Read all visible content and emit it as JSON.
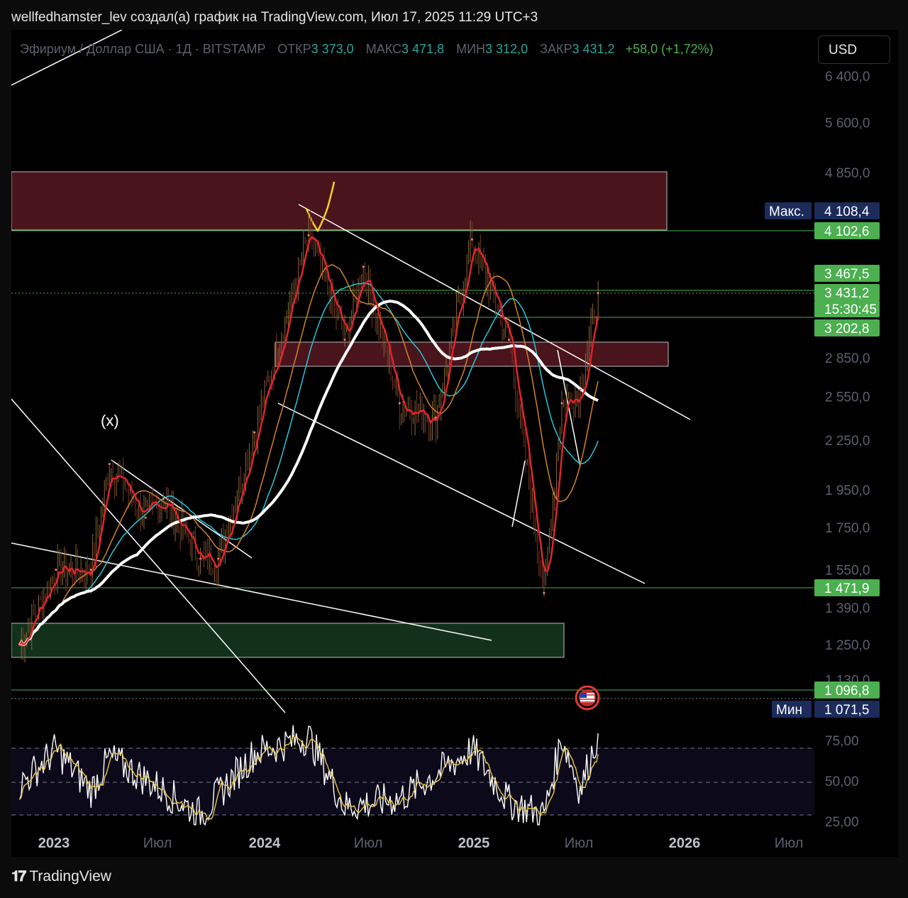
{
  "header": {
    "title": "wellfedhamster_lev создал(а) график на TradingView.com, Июл 17, 2025 11:29 UTC+3"
  },
  "legend": {
    "symbol": "Эфириум / Доллар США · 1Д · BITSTAMP",
    "open_label": "ОТКР",
    "open_value": "3 373,0",
    "high_label": "МАКС",
    "high_value": "3 471,8",
    "low_label": "МИН",
    "low_value": "3 312,0",
    "close_label": "ЗАКР",
    "close_value": "3 431,2",
    "change": "+58,0 (+1,72%)"
  },
  "currency_button": "USD",
  "annotation_x": "(x)",
  "footer": {
    "brand": "TradingView",
    "logo_icon": "tradingview-logo-icon"
  },
  "colors": {
    "up": "#26a69a",
    "down": "#ef5350",
    "ma_white": "#ffffff",
    "ma_red": "#e0242b",
    "ma_teal": "#26c6da",
    "ma_orange": "#d4822a",
    "zone_red": "#4a141c",
    "zone_green": "#13301a",
    "level_green": "#4caf50",
    "rsi_yellow": "#e8c547"
  },
  "chart_data": [
    {
      "type": "line",
      "name": "ETH/USD daily price",
      "y_scale": "log",
      "price_axis_ticks": [
        "6 400,0",
        "5 600,0",
        "4 850,0",
        "2 850,0",
        "2 550,0",
        "2 250,0",
        "1 950,0",
        "1 750,0",
        "1 550,0",
        "1 390,0",
        "1 250,0",
        "1 130,0"
      ],
      "price_tags": [
        {
          "label": "Макс.",
          "value": "4 108,4",
          "style": "navy"
        },
        {
          "value": "4 102,6",
          "style": "green"
        },
        {
          "value": "3 467,5",
          "style": "green"
        },
        {
          "value": "3 431,2",
          "style": "green"
        },
        {
          "value": "15:30:45",
          "style": "green"
        },
        {
          "value": "3 202,8",
          "style": "green"
        },
        {
          "value": "1 471,9",
          "style": "green"
        },
        {
          "value": "1 096,8",
          "style": "green"
        },
        {
          "label": "Мин",
          "value": "1 071,5",
          "style": "navy"
        }
      ],
      "time_axis_ticks": [
        {
          "label": "2023",
          "bold": true
        },
        {
          "label": "Июл",
          "bold": false
        },
        {
          "label": "2024",
          "bold": true
        },
        {
          "label": "Июл",
          "bold": false
        },
        {
          "label": "2025",
          "bold": true
        },
        {
          "label": "Июл",
          "bold": false
        },
        {
          "label": "2026",
          "bold": true
        },
        {
          "label": "Июл",
          "bold": false
        }
      ],
      "x": [
        "2022-11",
        "2023-01",
        "2023-03",
        "2023-04",
        "2023-06",
        "2023-07",
        "2023-09",
        "2023-10",
        "2023-12",
        "2024-03",
        "2024-05",
        "2024-06",
        "2024-08",
        "2024-10",
        "2024-12",
        "2025-02",
        "2025-04",
        "2025-05",
        "2025-06",
        "2025-07"
      ],
      "y": [
        1250,
        1550,
        1550,
        2100,
        1800,
        1900,
        1600,
        1600,
        2300,
        4050,
        3000,
        3700,
        2500,
        2400,
        4000,
        3000,
        1450,
        2500,
        2600,
        3431
      ],
      "zones": [
        {
          "color": "red",
          "y_range": [
            4100,
            4950
          ]
        },
        {
          "color": "red",
          "y_range": [
            2800,
            3020
          ]
        },
        {
          "color": "green",
          "y_range": [
            1200,
            1330
          ]
        }
      ],
      "horizontal_levels": [
        4102.6,
        3467.5,
        3202.8,
        1471.9,
        1096.8
      ]
    },
    {
      "type": "line",
      "name": "RSI",
      "axis_ticks": [
        "75,00",
        "50,00",
        "25,00"
      ],
      "ylim": [
        25,
        85
      ],
      "bands": [
        30,
        50,
        70
      ],
      "x": [
        "2022-11",
        "2023-01",
        "2023-03",
        "2023-04",
        "2023-06",
        "2023-09",
        "2023-12",
        "2024-03",
        "2024-05",
        "2024-08",
        "2024-12",
        "2025-02",
        "2025-04",
        "2025-05",
        "2025-06",
        "2025-07"
      ],
      "y": [
        48,
        70,
        45,
        65,
        52,
        30,
        68,
        78,
        35,
        40,
        70,
        38,
        30,
        78,
        45,
        80
      ]
    }
  ]
}
